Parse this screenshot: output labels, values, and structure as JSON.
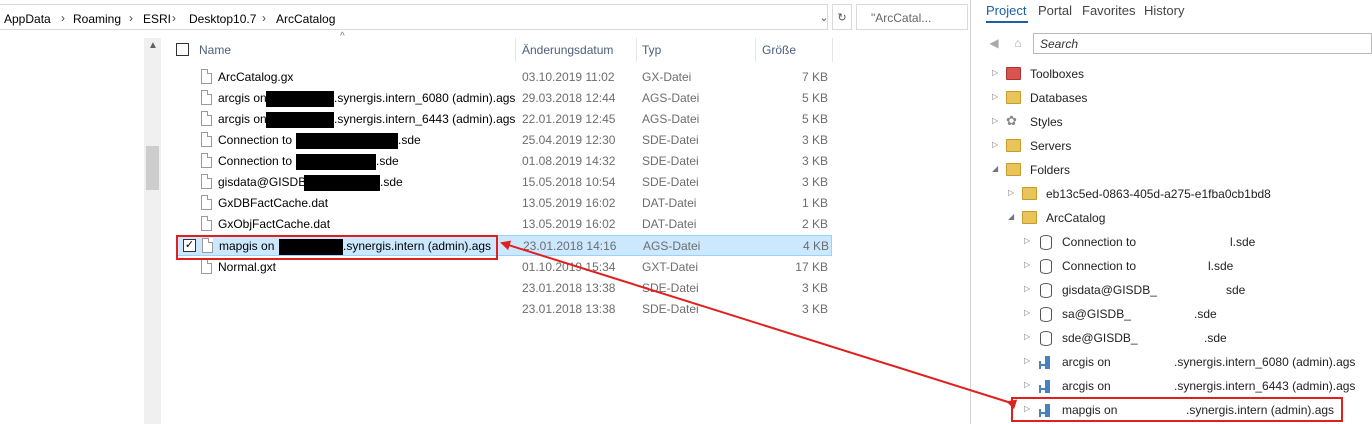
{
  "explorer": {
    "breadcrumb": [
      "AppData",
      "Roaming",
      "ESRI",
      "Desktop10.7",
      "ArcCatalog"
    ],
    "search_placeholder": "\"ArcCatal...",
    "columns": {
      "name": "Name",
      "date": "Änderungsdatum",
      "type": "Typ",
      "size": "Größe"
    },
    "rows": [
      {
        "name": "ArcCatalog.gx",
        "date": "03.10.2019 11:02",
        "type": "GX-Datei",
        "size": "7 KB"
      },
      {
        "name_pre": "arcgis on ",
        "name_post": ".synergis.intern_6080 (admin).ags",
        "date": "29.03.2018 12:44",
        "type": "AGS-Datei",
        "size": "5 KB"
      },
      {
        "name_pre": "arcgis on ",
        "name_post": ".synergis.intern_6443 (admin).ags",
        "date": "22.01.2019 12:45",
        "type": "AGS-Datei",
        "size": "5 KB"
      },
      {
        "name_pre": "Connection to ",
        "name_post": ".sde",
        "date": "25.04.2019 12:30",
        "type": "SDE-Datei",
        "size": "3 KB"
      },
      {
        "name_pre": "Connection to ",
        "name_post": ".sde",
        "date": "01.08.2019 14:32",
        "type": "SDE-Datei",
        "size": "3 KB"
      },
      {
        "name_pre": "gisdata@GISDB_",
        "name_post": ".sde",
        "date": "15.05.2018 10:54",
        "type": "SDE-Datei",
        "size": "3 KB"
      },
      {
        "name": "GxDBFactCache.dat",
        "date": "13.05.2019 16:02",
        "type": "DAT-Datei",
        "size": "1 KB"
      },
      {
        "name": "GxObjFactCache.dat",
        "date": "13.05.2019 16:02",
        "type": "DAT-Datei",
        "size": "2 KB"
      },
      {
        "name_pre": "mapgis on ",
        "name_post": ".synergis.intern (admin).ags",
        "date": "23.01.2018 14:16",
        "type": "AGS-Datei",
        "size": "4 KB"
      },
      {
        "name": "Normal.gxt",
        "date": "01.10.2019 15:34",
        "type": "GXT-Datei",
        "size": "17 KB"
      },
      {
        "name": "",
        "date": "23.01.2018 13:38",
        "type": "SDE-Datei",
        "size": "3 KB"
      },
      {
        "name": "",
        "date": "23.01.2018 13:38",
        "type": "SDE-Datei",
        "size": "3 KB"
      }
    ]
  },
  "catalog": {
    "tabs": [
      "Project",
      "Portal",
      "Favorites",
      "History"
    ],
    "search_placeholder": "Search",
    "tree": [
      {
        "label": "Toolboxes"
      },
      {
        "label": "Databases"
      },
      {
        "label": "Styles"
      },
      {
        "label": "Servers"
      },
      {
        "label": "Folders"
      },
      {
        "label": "eb13c5ed-0863-405d-a275-e1fba0cb1bd8"
      },
      {
        "label": "ArcCatalog"
      },
      {
        "label_pre": "Connection to",
        "label_post": "l.sde"
      },
      {
        "label_pre": "Connection to",
        "label_post": "l.sde"
      },
      {
        "label_pre": "gisdata@GISDB_",
        "label_post": "sde"
      },
      {
        "label_pre": "sa@GISDB_",
        "label_post": ".sde"
      },
      {
        "label_pre": "sde@GISDB_",
        "label_post": ".sde"
      },
      {
        "label_pre": "arcgis on",
        "label_post": ".synergis.intern_6080 (admin).ags"
      },
      {
        "label_pre": "arcgis on",
        "label_post": ".synergis.intern_6443 (admin).ags"
      },
      {
        "label_pre": "mapgis on",
        "label_post": ".synergis.intern (admin).ags"
      }
    ]
  },
  "colors": {
    "highlight": "#e0201e",
    "selection": "#cce8ff",
    "accent": "#1a5fa8"
  }
}
